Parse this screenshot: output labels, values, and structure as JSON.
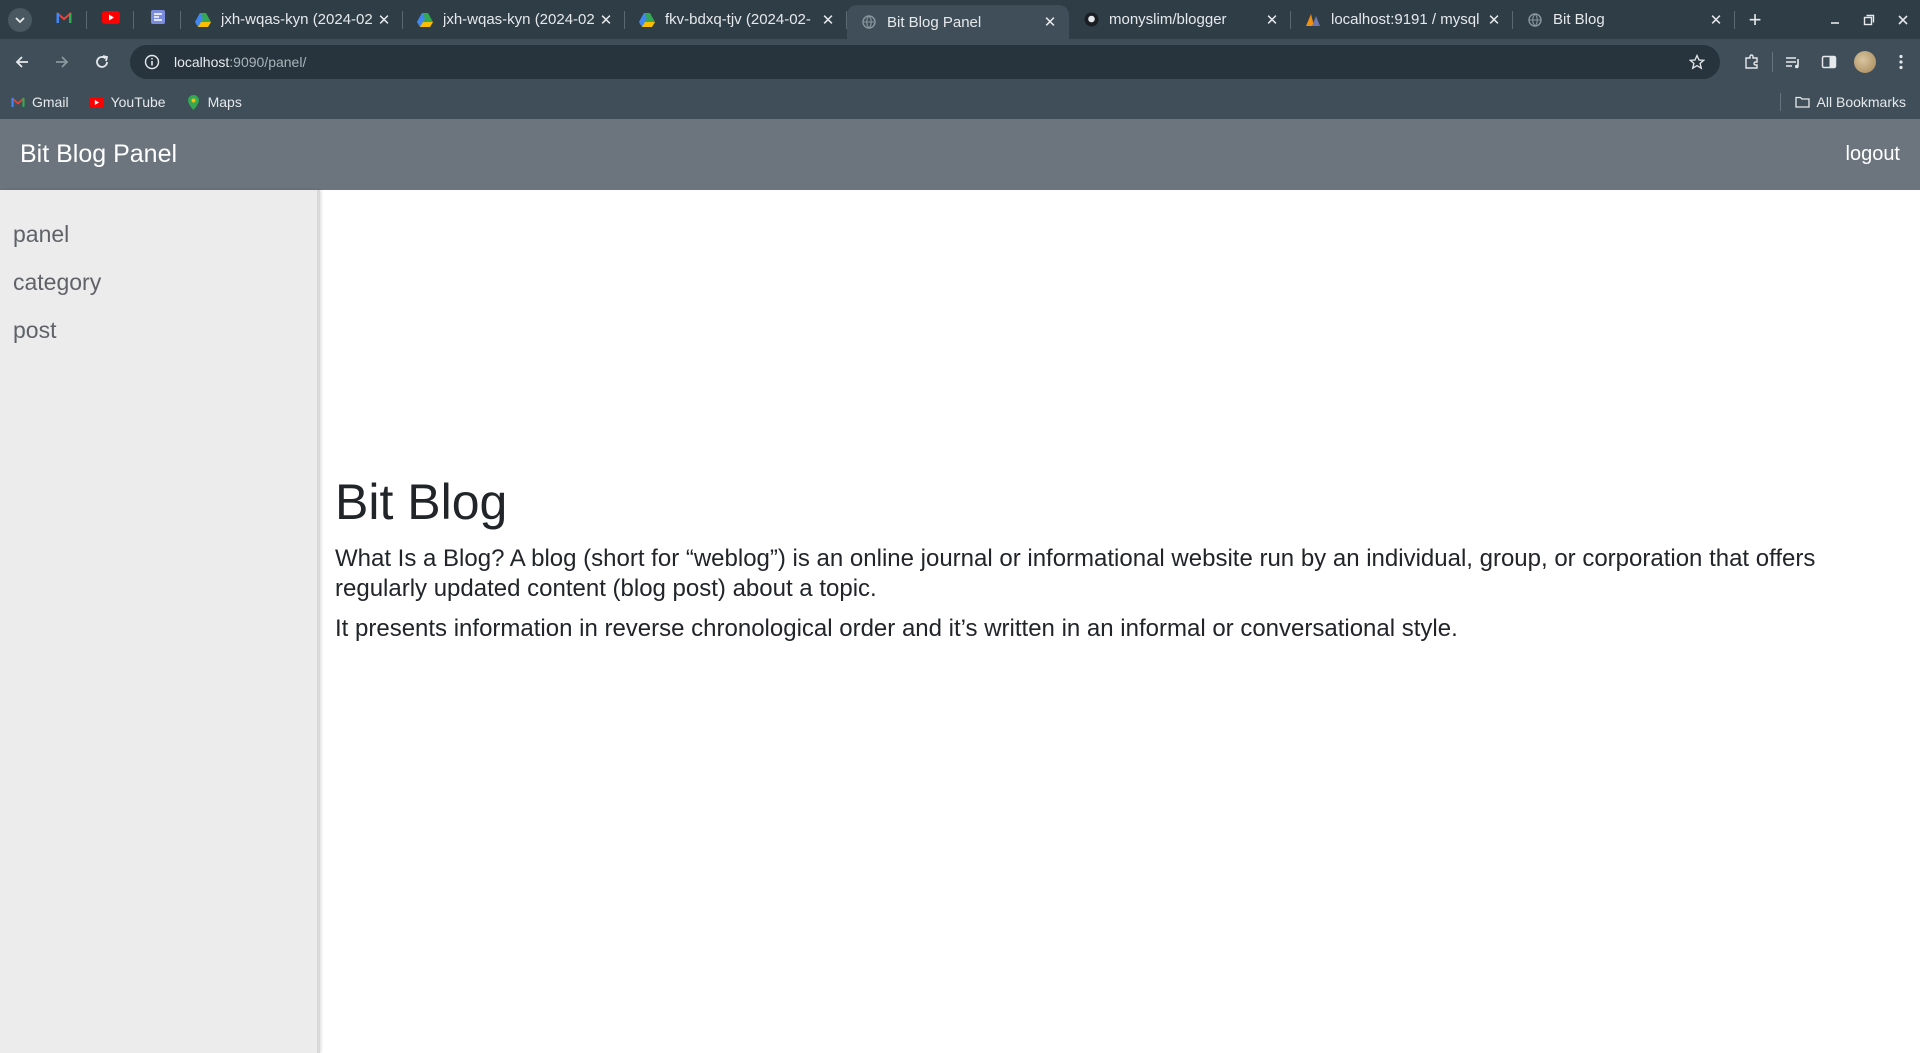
{
  "browser": {
    "tabs": [
      {
        "title": "jxh-wqas-kyn (2024-02",
        "icon": "google-drive-icon"
      },
      {
        "title": "jxh-wqas-kyn (2024-02",
        "icon": "google-drive-icon"
      },
      {
        "title": "fkv-bdxq-tjv (2024-02-",
        "icon": "google-drive-icon"
      },
      {
        "title": "Bit Blog Panel",
        "icon": "globe-icon",
        "active": true
      },
      {
        "title": "monyslim/blogger",
        "icon": "github-icon"
      },
      {
        "title": "localhost:9191 / mysql",
        "icon": "phpmyadmin-icon"
      },
      {
        "title": "Bit Blog",
        "icon": "globe-icon"
      }
    ],
    "url_host": "localhost",
    "url_rest": ":9090/panel/",
    "bookmarks": [
      {
        "label": "Gmail",
        "icon": "gmail-icon"
      },
      {
        "label": "YouTube",
        "icon": "youtube-icon"
      },
      {
        "label": "Maps",
        "icon": "maps-icon"
      }
    ],
    "all_bookmarks": "All Bookmarks"
  },
  "navbar": {
    "brand": "Bit Blog Panel",
    "logout": "logout",
    "color": "#6c757d"
  },
  "sidebar": {
    "items": [
      {
        "label": "panel"
      },
      {
        "label": "category"
      },
      {
        "label": "post"
      }
    ]
  },
  "main": {
    "title": "Bit Blog",
    "paragraphs": [
      "What Is a Blog? A blog (short for “weblog”) is an online journal or informational website run by an individual, group, or corporation that offers regularly updated content (blog post) about a topic.",
      "It presents information in reverse chronological order and it’s written in an informal or conversational style."
    ]
  }
}
